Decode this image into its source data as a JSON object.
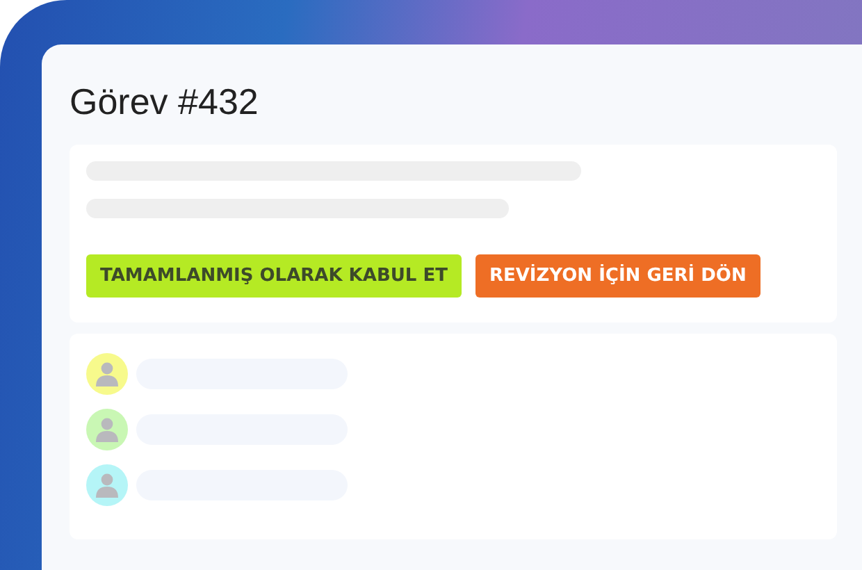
{
  "task": {
    "title": "Görev #432"
  },
  "actions": [
    {
      "label": "TAMAMLANMIŞ OLARAK KABUL ET",
      "kind": "accept"
    },
    {
      "label": "REVİZYON İÇİN GERİ DÖN",
      "kind": "revise"
    }
  ],
  "assignees": [
    {
      "color": "#f7fa8c"
    },
    {
      "color": "#c9f7b4"
    },
    {
      "color": "#b5f5f7"
    }
  ]
}
